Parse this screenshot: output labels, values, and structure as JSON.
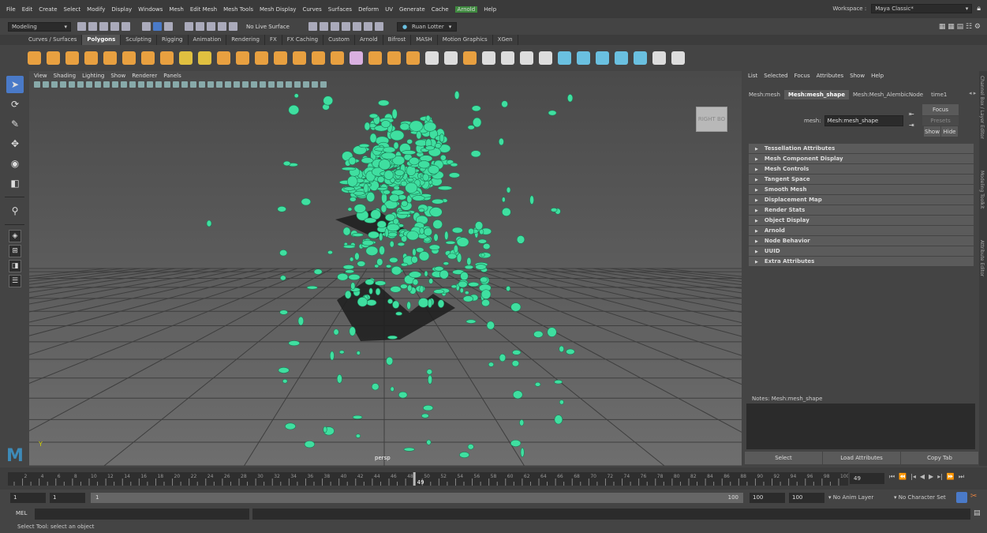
{
  "menubar": {
    "items": [
      "File",
      "Edit",
      "Create",
      "Select",
      "Modify",
      "Display",
      "Windows",
      "Mesh",
      "Edit Mesh",
      "Mesh Tools",
      "Mesh Display",
      "Curves",
      "Surfaces",
      "Deform",
      "UV",
      "Generate",
      "Cache",
      "Arnold",
      "Help"
    ],
    "workspace_label": "Workspace :",
    "workspace_value": "Maya Classic*"
  },
  "statusline": {
    "mode": "Modeling",
    "live_surface": "No Live Surface",
    "user": "Ruan Lotter"
  },
  "shelf_tabs": [
    "Curves / Surfaces",
    "Polygons",
    "Sculpting",
    "Rigging",
    "Animation",
    "Rendering",
    "FX",
    "FX Caching",
    "Custom",
    "Arnold",
    "Bifrost",
    "MASH",
    "Motion Graphics",
    "XGen"
  ],
  "shelf_active_tab": "Polygons",
  "shelf_icon_colors": [
    "#e8a040",
    "#e8a040",
    "#e8a040",
    "#e8a040",
    "#e8a040",
    "#e8a040",
    "#e8a040",
    "#e8a040",
    "#e0c040",
    "#e0c040",
    "#e8a040",
    "#e8a040",
    "#e8a040",
    "#e8a040",
    "#e8a040",
    "#e8a040",
    "#e8a040",
    "#d9b0e0",
    "#e8a040",
    "#e8a040",
    "#e8a040",
    "#ddd",
    "#ddd",
    "#e8a040",
    "#ddd",
    "#ddd",
    "#ddd",
    "#ddd",
    "#6ac0e0",
    "#6ac0e0",
    "#6ac0e0",
    "#6ac0e0",
    "#6ac0e0",
    "#ddd",
    "#ddd"
  ],
  "viewport": {
    "menu": [
      "View",
      "Shading",
      "Lighting",
      "Show",
      "Renderer",
      "Panels"
    ],
    "camera": "persp",
    "viewcube_label": "RIGHT  BO",
    "axis_label": "Y",
    "mesh_color": "#3fdfa0"
  },
  "attribute_editor": {
    "menu": [
      "List",
      "Selected",
      "Focus",
      "Attributes",
      "Show",
      "Help"
    ],
    "tabs": [
      "Mesh:mesh",
      "Mesh:mesh_shape",
      "Mesh:Mesh_AlembicNode",
      "time1"
    ],
    "active_tab": "Mesh:mesh_shape",
    "mesh_label": "mesh:",
    "mesh_value": "Mesh:mesh_shape",
    "focus_btn": "Focus",
    "presets_btn": "Presets",
    "show_btn": "Show",
    "hide_btn": "Hide",
    "sections": [
      "Tessellation Attributes",
      "Mesh Component Display",
      "Mesh Controls",
      "Tangent Space",
      "Smooth Mesh",
      "Displacement Map",
      "Render Stats",
      "Object Display",
      "Arnold",
      "Node Behavior",
      "UUID",
      "Extra Attributes"
    ],
    "notes_label": "Notes: Mesh:mesh_shape",
    "select_btn": "Select",
    "load_btn": "Load Attributes",
    "copy_btn": "Copy Tab",
    "side_tabs": [
      "Channel Box / Layer Editor",
      "Modeling Toolkit",
      "Attribute Editor"
    ]
  },
  "timeline": {
    "ticks": [
      "2",
      "4",
      "6",
      "8",
      "10",
      "12",
      "14",
      "16",
      "18",
      "20",
      "22",
      "24",
      "26",
      "28",
      "30",
      "32",
      "34",
      "36",
      "38",
      "40",
      "42",
      "44",
      "46",
      "48",
      "50",
      "52",
      "54",
      "56",
      "58",
      "60",
      "62",
      "64",
      "66",
      "68",
      "70",
      "72",
      "74",
      "76",
      "78",
      "80",
      "82",
      "84",
      "86",
      "88",
      "90",
      "92",
      "94",
      "96",
      "98",
      "100"
    ],
    "playhead": "49",
    "current_frame": "49"
  },
  "range": {
    "start": "1",
    "anim_start": "1",
    "slider_start": "1",
    "slider_end": "100",
    "end": "100",
    "anim_end": "100",
    "anim_layer": "No Anim Layer",
    "char_set": "No Character Set"
  },
  "cmdline": {
    "lang": "MEL"
  },
  "helpline": "Select Tool: select an object"
}
